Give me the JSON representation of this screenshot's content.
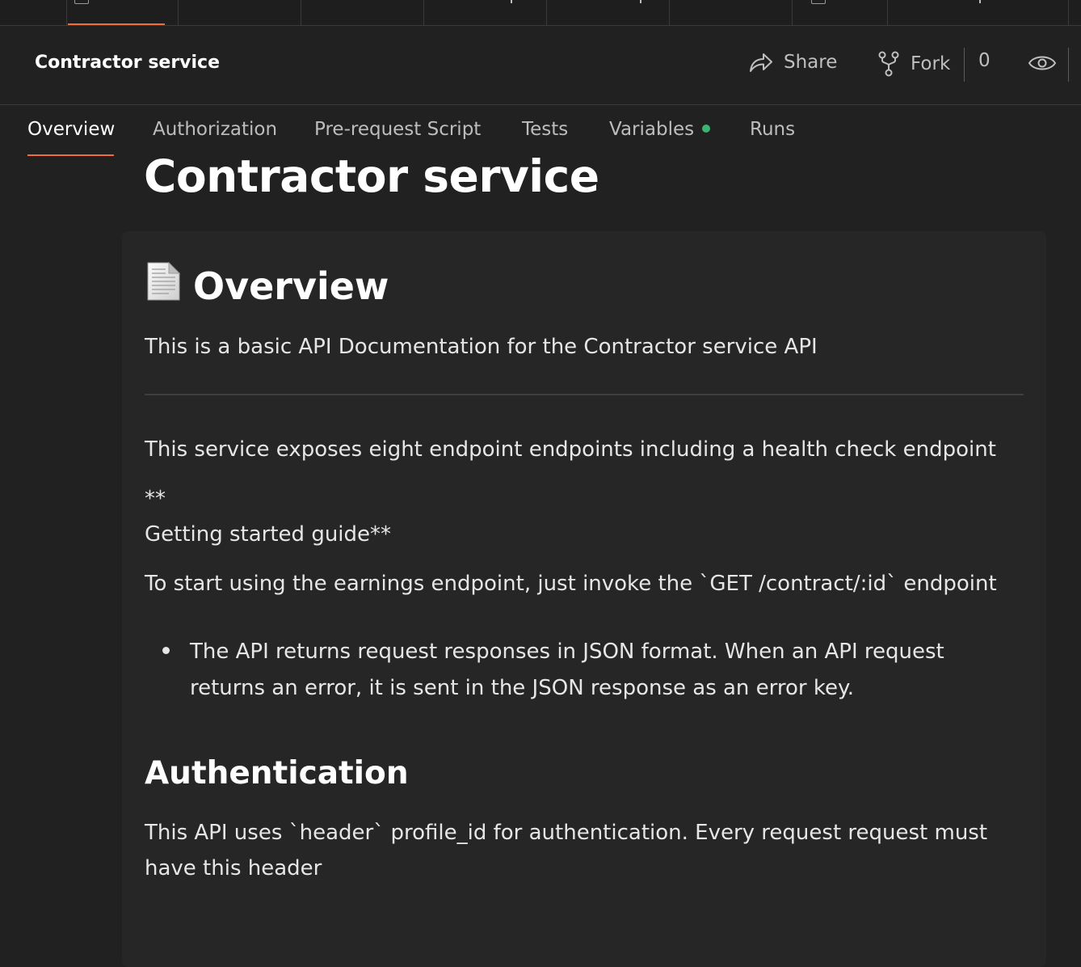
{
  "header": {
    "title": "Contractor service",
    "share_label": "Share",
    "fork_label": "Fork",
    "fork_count": "0"
  },
  "tabs": [
    {
      "label": "Overview",
      "active": true
    },
    {
      "label": "Authorization"
    },
    {
      "label": "Pre-request Script"
    },
    {
      "label": "Tests"
    },
    {
      "label": "Variables",
      "indicator_color": "#3cb371"
    },
    {
      "label": "Runs"
    }
  ],
  "doc": {
    "page_title": "Contractor service",
    "overview_heading": "Overview",
    "intro": "This is a basic API Documentation for the Contractor service API",
    "endpoints_text": "This service exposes eight endpoint endpoints including a health check endpoint",
    "stars": "**",
    "getting_started": "Getting started guide**",
    "start_text": "To start using the earnings endpoint, just invoke the `GET /contract/:id` endpoint",
    "bullet": "The API returns request responses in JSON format. When an API request returns an error, it is sent in the JSON response as an error key.",
    "auth_heading": "Authentication",
    "auth_text": "This API uses `header` profile_id for authentication. Every request request must have this header"
  },
  "colors": {
    "accent": "#f26b3a",
    "background": "#212121",
    "card": "#262626"
  },
  "icons": [
    "share-icon",
    "fork-icon",
    "eye-icon",
    "document-icon"
  ]
}
